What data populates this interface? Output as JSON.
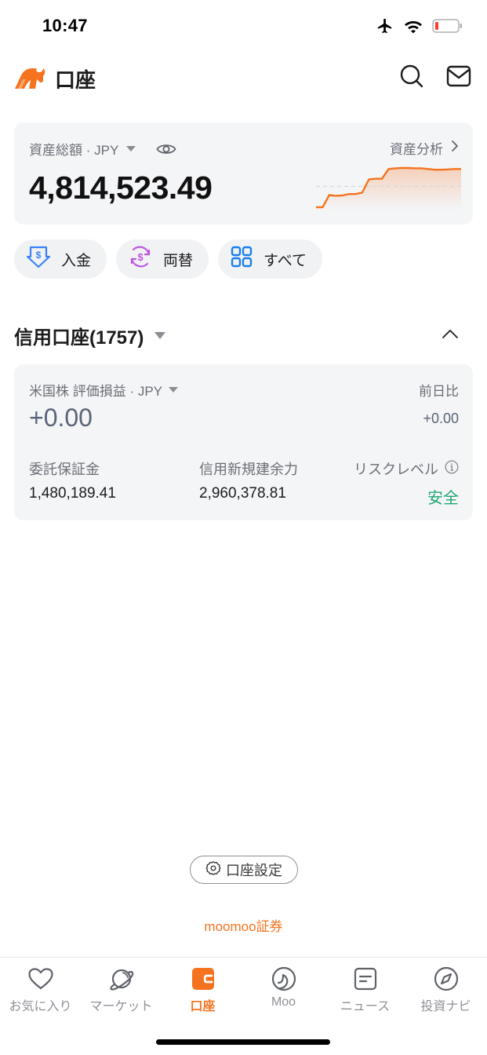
{
  "status_bar": {
    "time": "10:47",
    "icons": [
      "airplane-icon",
      "wifi-icon",
      "battery-low-icon"
    ]
  },
  "header": {
    "title": "口座",
    "logo": "moomoo-bull-logo",
    "actions": [
      "search-icon",
      "mail-icon"
    ]
  },
  "asset_summary": {
    "label": "資産総額 · JPY",
    "total": "4,814,523.49",
    "analysis_link": "資産分析",
    "accent_color": "#f5731f",
    "sparkline": [
      0.0,
      0.0,
      0.35,
      0.33,
      0.34,
      0.38,
      0.38,
      0.42,
      0.8,
      0.82,
      0.82,
      1.1,
      1.12,
      1.13,
      1.13,
      1.12,
      1.12,
      1.1,
      1.08,
      1.08,
      1.09,
      1.1,
      1.1
    ],
    "sparkline_baseline": 0.6
  },
  "quick_actions": [
    {
      "label": "入金",
      "icon": "deposit-icon",
      "color": "#3a82f7"
    },
    {
      "label": "両替",
      "icon": "currency-exchange-icon",
      "color": "#c056e0"
    },
    {
      "label": "すべて",
      "icon": "grid-icon",
      "color": "#1b7ff0"
    }
  ],
  "account_section": {
    "title": "信用口座(1757)",
    "collapse_icon": "chevron-up-icon"
  },
  "margin_card": {
    "pl_label": "米国株 評価損益 · JPY",
    "pl_value": "+0.00",
    "day_change_label": "前日比",
    "day_change_value": "+0.00",
    "metrics": [
      {
        "label": "委託保証金",
        "value": "1,480,189.41"
      },
      {
        "label": "信用新規建余力",
        "value": "2,960,378.81"
      },
      {
        "label": "リスクレベル",
        "value": "安全",
        "value_color": "#1fa873"
      }
    ]
  },
  "footer": {
    "settings_label": "口座設定",
    "brand": "moomoo証券"
  },
  "tab_bar": {
    "active_index": 2,
    "tabs": [
      {
        "label": "お気に入り",
        "icon": "heart-icon"
      },
      {
        "label": "マーケット",
        "icon": "planet-icon"
      },
      {
        "label": "口座",
        "icon": "wallet-icon"
      },
      {
        "label": "Moo",
        "icon": "moo-icon"
      },
      {
        "label": "ニュース",
        "icon": "news-icon"
      },
      {
        "label": "投資ナビ",
        "icon": "compass-icon"
      }
    ]
  }
}
